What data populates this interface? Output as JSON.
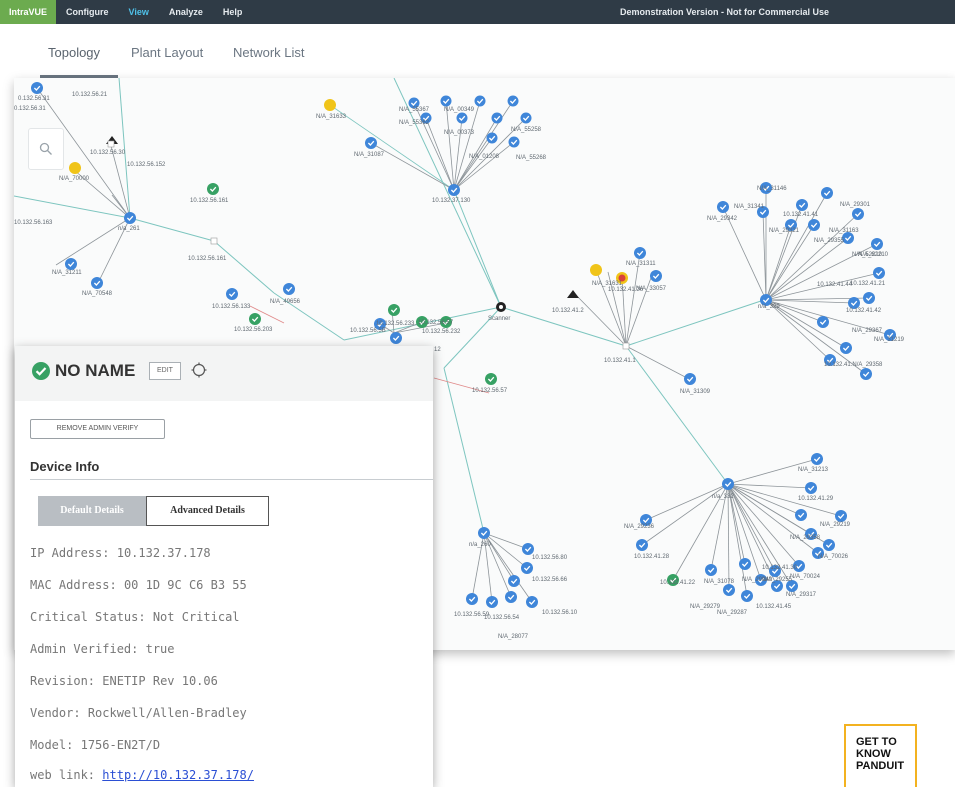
{
  "topbar": {
    "brand": "IntraVUE",
    "menus": [
      "Configure",
      "View",
      "Analyze",
      "Help"
    ],
    "active_menu": "View",
    "notice": "Demonstration Version - Not for Commercial Use"
  },
  "tabs": [
    "Topology",
    "Plant Layout",
    "Network List"
  ],
  "active_tab": "Topology",
  "map": {
    "center_label": "Scanner",
    "node_labels": [
      "10.132.56.21",
      "0.132.56.31",
      "10.132.56.30",
      "10.132.56.152",
      "N/A_70000",
      "10.132.56.161",
      "10.132.56.163",
      "n/a_261",
      "N/A_31211",
      "N/A_70548",
      "10.132.56.161",
      "10.132.56.133",
      "N/A_49656",
      "10.132.56.203",
      "10.132.56.233",
      "10.132.56.5B",
      "10.132.56.232",
      "10.132.56.57",
      "12",
      "N/A_31633",
      "N/A_31087",
      "N/A_55367",
      "N/A_00349",
      "N/A_55362",
      "N/A_00373",
      "N/A_55258",
      "N/A_01208",
      "N/A_55268",
      "10.132.37.130",
      "N/A_31146",
      "N/A_31341",
      "N/A_29301",
      "N/A_29342",
      "10.132.41.41",
      "N/A_29321",
      "N/A_31163",
      "N/A_29355",
      "10.132.41.42",
      "N/A_52210",
      "N/A_62210",
      "10.132.41.44",
      "10.132.41.21",
      "n/a_329",
      "N/A_29367",
      "N/A_31219",
      "10.132.41.N/A_29358",
      "10.132.41.2",
      "N/A_31311",
      "N/A_31631",
      "10.132.41.26",
      "N/A_33057",
      "10.132.41.1",
      "N/A_31309",
      "N/A_31213",
      "n/a_332",
      "10.132.41.29",
      "N/A_29219",
      "N/A_29236",
      "N/A_29358",
      "N/A_70026",
      "10.132.41.28",
      "10.132.41.30",
      "N/A_70024",
      "10.132.41.22",
      "N/A_31078",
      "N/A_29249",
      "N/A_29255",
      "N/A_29317",
      "N/A_29279",
      "N/A_29287",
      "10.132.41.45",
      "n/a_260",
      "10.132.56.80",
      "10.132.56.66",
      "10.132.56.10",
      "10.132.56.59",
      "10.132.56.54",
      "N/A_28077"
    ]
  },
  "panel": {
    "title": "NO NAME",
    "edit_label": "EDIT",
    "remove_label": "REMOVE ADMIN VERIFY",
    "section_title": "Device Info",
    "tab_default": "Default Details",
    "tab_advanced": "Advanced Details",
    "fields": [
      {
        "label": "IP Address:",
        "value": "10.132.37.178"
      },
      {
        "label": "MAC Address:",
        "value": "00 1D 9C C6 B3 55"
      },
      {
        "label": "Critical Status:",
        "value": "Not Critical"
      },
      {
        "label": "Admin Verified:",
        "value": "true"
      },
      {
        "label": "Revision:",
        "value": "ENETIP Rev 10.06"
      },
      {
        "label": "Vendor:",
        "value": "Rockwell/Allen-Bradley"
      },
      {
        "label": "Model:",
        "value": "1756-EN2T/D"
      }
    ],
    "weblink_label": "web link:",
    "weblink_url": "http://10.132.37.178/"
  },
  "promo": {
    "lines": [
      "GET TO",
      "KNOW",
      "PANDUIT"
    ]
  },
  "colors": {
    "topbar": "#2f3b46",
    "brand": "#6cab4f",
    "node_blue": "#3f86d9",
    "node_green": "#37a164",
    "node_yellow": "#f0c419",
    "link_teal": "#7dc5bf",
    "link_grey": "#8d9499",
    "link_red": "#e08a8a",
    "promo_border": "#f3b220"
  }
}
